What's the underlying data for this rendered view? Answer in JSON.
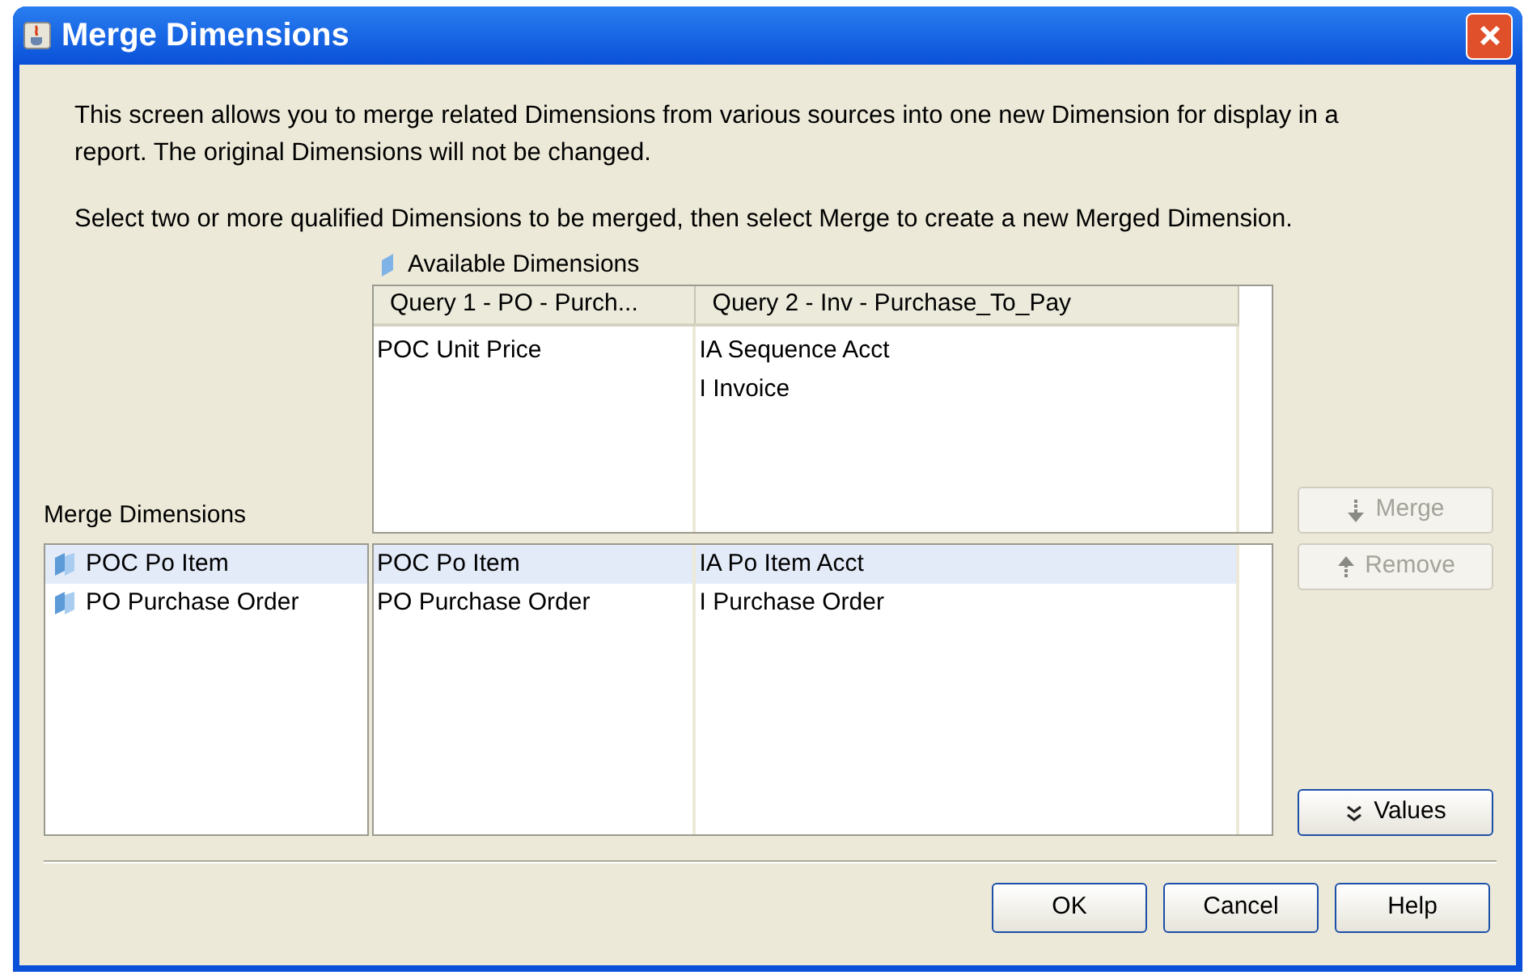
{
  "window": {
    "title": "Merge Dimensions"
  },
  "description": [
    "This screen allows you to merge related Dimensions from various sources into one new Dimension for display in a report. The original Dimensions will not be changed.",
    "Select two or more qualified Dimensions to be merged, then select Merge to create a new Merged Dimension."
  ],
  "available_dimensions": {
    "label": "Available Dimensions",
    "columns": [
      {
        "header": "Query 1 - PO - Purch...",
        "items": [
          "POC Unit Price"
        ]
      },
      {
        "header": "Query 2 - Inv - Purchase_To_Pay",
        "items": [
          "IA Sequence Acct",
          "I Invoice"
        ]
      }
    ]
  },
  "merged_rows": [
    {
      "cells": [
        "POC Po Item",
        "IA Po Item Acct"
      ],
      "selected": true
    },
    {
      "cells": [
        "PO Purchase Order",
        "I Purchase Order"
      ],
      "selected": false
    }
  ],
  "merge_dimensions": {
    "label": "Merge Dimensions",
    "items": [
      {
        "label": "POC Po Item",
        "selected": true
      },
      {
        "label": "PO Purchase Order",
        "selected": false
      }
    ]
  },
  "side_buttons": [
    {
      "label": "Merge",
      "kind": "down",
      "disabled": true
    },
    {
      "label": "Remove",
      "kind": "up",
      "disabled": true
    },
    {
      "label": "Values",
      "kind": "chevrons",
      "disabled": false
    }
  ],
  "buttons": [
    "OK",
    "Cancel",
    "Help"
  ]
}
